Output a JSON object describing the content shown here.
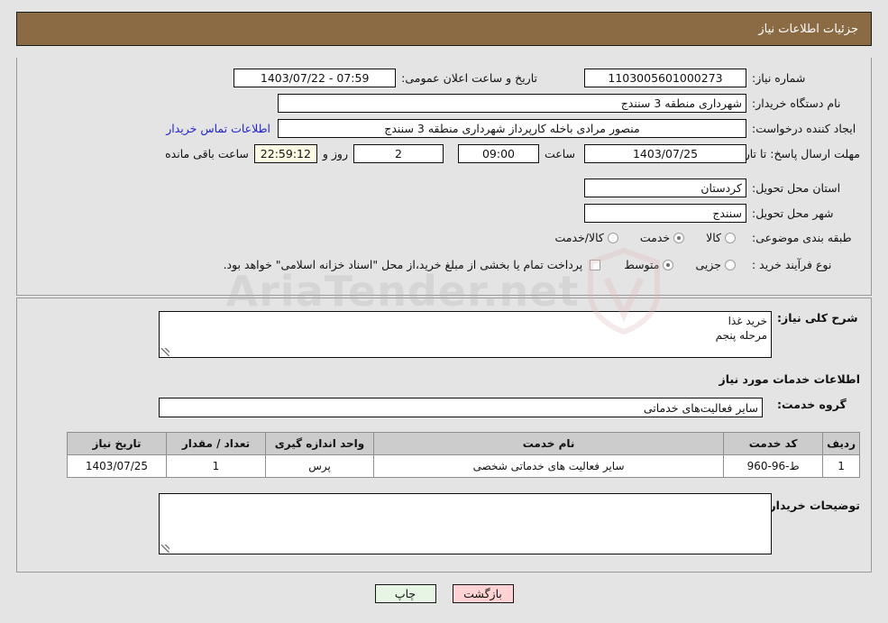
{
  "header": {
    "title": "جزئیات اطلاعات نیاز"
  },
  "form": {
    "need_number_label": "شماره نیاز:",
    "need_number_value": "1103005601000273",
    "announce_label": "تاریخ و ساعت اعلان عمومی:",
    "announce_value": "07:59 - 1403/07/22",
    "buyer_org_label": "نام دستگاه خریدار:",
    "buyer_org_value": "شهرداری منطقه 3 سنندج",
    "creator_label": "ایجاد کننده درخواست:",
    "creator_value": "منصور مرادی باخله کارپرداز شهرداری منطقه 3 سنندج",
    "contact_link": "اطلاعات تماس خریدار",
    "deadline_label": "مهلت ارسال پاسخ: تا تاریخ:",
    "deadline_date": "1403/07/25",
    "time_label": "ساعت",
    "time_value": "09:00",
    "days_value": "2",
    "days_suffix": "روز و",
    "countdown_value": "22:59:12",
    "countdown_suffix": "ساعت باقی مانده",
    "province_label": "استان محل تحویل:",
    "province_value": "کردستان",
    "city_label": "شهر محل تحویل:",
    "city_value": "سنندج",
    "category_label": "طبقه بندی موضوعی:",
    "category_options": [
      {
        "label": "کالا",
        "selected": false
      },
      {
        "label": "خدمت",
        "selected": true
      },
      {
        "label": "کالا/خدمت",
        "selected": false
      }
    ],
    "process_label": "نوع فرآیند خرید :",
    "process_options": [
      {
        "label": "جزیی",
        "selected": false
      },
      {
        "label": "متوسط",
        "selected": true
      }
    ],
    "treasury_note": "پرداخت تمام یا بخشی از مبلغ خرید،از محل \"اسناد خزانه اسلامی\" خواهد بود."
  },
  "description": {
    "label": "شرح کلی نیاز:",
    "value": "خرید غذا\nمرحله پنجم"
  },
  "services": {
    "section_title": "اطلاعات خدمات مورد نیاز",
    "group_label": "گروه خدمت:",
    "group_value": "سایر فعالیت‌های خدماتی",
    "columns": [
      "ردیف",
      "کد خدمت",
      "نام خدمت",
      "واحد اندازه گیری",
      "تعداد / مقدار",
      "تاریخ نیاز"
    ],
    "rows": [
      {
        "radif": "1",
        "code": "ط-96-960",
        "name": "سایر فعالیت های خدماتی شخصی",
        "unit": "پرس",
        "quantity": "1",
        "need_date": "1403/07/25"
      }
    ]
  },
  "notes": {
    "label": "توضیحات خریدار:",
    "value": ""
  },
  "buttons": {
    "print": "چاپ",
    "back": "بازگشت"
  },
  "watermark": {
    "text": "AriaTender.net"
  },
  "colors": {
    "header_bg": "#8b6b43",
    "page_bg": "#e4e4e4",
    "link": "#2222cc",
    "table_header_bg": "#cccccc",
    "print_btn_bg": "#e6f5e4",
    "back_btn_bg": "#ffd3d3",
    "countdown_bg": "#fbf8e3"
  }
}
